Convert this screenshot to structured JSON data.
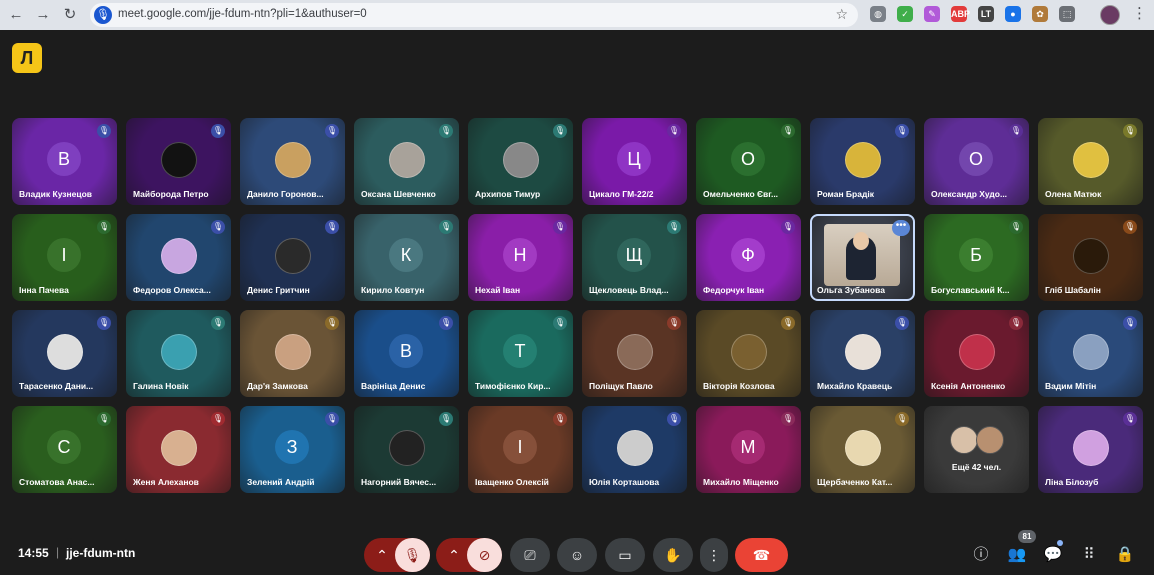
{
  "browser": {
    "url": "meet.google.com/jje-fdum-ntn?pli=1&authuser=0",
    "extensions": [
      {
        "name": "globe-icon",
        "color": "#7a8088",
        "glyph": "◍"
      },
      {
        "name": "shield-extension-icon",
        "color": "#3fae4a",
        "glyph": "✓"
      },
      {
        "name": "pen-extension-icon",
        "color": "#b15ad8",
        "glyph": "✎"
      },
      {
        "name": "adblock-extension-icon",
        "color": "#e23b3b",
        "glyph": "ABP"
      },
      {
        "name": "lt-extension-icon",
        "color": "#444",
        "glyph": "LT"
      },
      {
        "name": "blue-dot-extension-icon",
        "color": "#1a73e8",
        "glyph": "●"
      },
      {
        "name": "owl-extension-icon",
        "color": "#b07a3a",
        "glyph": "✿"
      },
      {
        "name": "puzzle-extensions-icon",
        "color": "#6b6f75",
        "glyph": "⬚"
      }
    ]
  },
  "meet": {
    "logo": "Л",
    "participants": [
      {
        "name": "Владик Кузнецов",
        "initial": "В",
        "bg": "#6a26a6",
        "avatar": "#7f3fbf",
        "mic": "#3b4fa8"
      },
      {
        "name": "Майборода Петро",
        "initial": "",
        "bg": "#3d1460",
        "avatar": "#121212",
        "mic": "#3b4fa8",
        "photo": true
      },
      {
        "name": "Данило Горонов...",
        "initial": "",
        "bg": "#2d4a78",
        "avatar": "#c9a060",
        "mic": "#3b4fa8",
        "photo": true
      },
      {
        "name": "Оксана Шевченко",
        "initial": "",
        "bg": "#2c5c5e",
        "avatar": "#a8a29a",
        "mic": "#2c7a74",
        "photo": true
      },
      {
        "name": "Архипов Тимур",
        "initial": "",
        "bg": "#1d4a42",
        "avatar": "#888",
        "mic": "#2c7a74",
        "photo": true
      },
      {
        "name": "Цикало ГМ-22/2",
        "initial": "Ц",
        "bg": "#7a1aa8",
        "avatar": "#8f34c4",
        "mic": "#6a28a0"
      },
      {
        "name": "Омельченко Євг...",
        "initial": "О",
        "bg": "#1e5a22",
        "avatar": "#2b6f2f",
        "mic": "#2c6a2f"
      },
      {
        "name": "Роман Брадік",
        "initial": "",
        "bg": "#2a3a6a",
        "avatar": "#d8b43a",
        "mic": "#3b4fa8",
        "photo": true
      },
      {
        "name": "Олександр Худо...",
        "initial": "О",
        "bg": "#5e2d96",
        "avatar": "#7346ad",
        "mic": "#5a2f96"
      },
      {
        "name": "Олена Матюк",
        "initial": "",
        "bg": "#565a2a",
        "avatar": "#e0c040",
        "mic": "#7a7a2a",
        "photo": true
      },
      {
        "name": "Інна Пачева",
        "initial": "І",
        "bg": "#285e1c",
        "avatar": "#38722b",
        "mic": "#2c6a2f"
      },
      {
        "name": "Федоров Олекса...",
        "initial": "",
        "bg": "#21466e",
        "avatar": "#c8a6e0",
        "mic": "#3b4fa8",
        "photo": true
      },
      {
        "name": "Денис Гритчин",
        "initial": "",
        "bg": "#1f3052",
        "avatar": "#2a2a2a",
        "mic": "#3b4fa8",
        "photo": true
      },
      {
        "name": "Кирило Ковтун",
        "initial": "К",
        "bg": "#38626a",
        "avatar": "#4a7880",
        "mic": "#2c7a74"
      },
      {
        "name": "Нехай Іван",
        "initial": "Н",
        "bg": "#8a1ea8",
        "avatar": "#a23ac2",
        "mic": "#6a28a0"
      },
      {
        "name": "Щекловець Влад...",
        "initial": "Щ",
        "bg": "#23524a",
        "avatar": "#2f665c",
        "mic": "#2c7a74"
      },
      {
        "name": "Федорчук Іван",
        "initial": "Ф",
        "bg": "#8a20b2",
        "avatar": "#a33ccb",
        "mic": "#6a28a0"
      },
      {
        "name": "Ольга Зубанова",
        "initial": "",
        "bg": "#3a3f4a",
        "avatar": "",
        "mic": "",
        "selfview": true
      },
      {
        "name": "Богуславський К...",
        "initial": "Б",
        "bg": "#2c6a22",
        "avatar": "#3b7e2f",
        "mic": "#2c6a2f"
      },
      {
        "name": "Гліб Шабалін",
        "initial": "",
        "bg": "#4a2a14",
        "avatar": "#2a1a0a",
        "mic": "#8a4a1a",
        "photo": true
      },
      {
        "name": "Тарасенко Дани...",
        "initial": "",
        "bg": "#24385e",
        "avatar": "#ddd",
        "mic": "#3b4fa8",
        "photo": true
      },
      {
        "name": "Галина Новік",
        "initial": "",
        "bg": "#1f5a5e",
        "avatar": "#3aa0b0",
        "mic": "#2c7a74",
        "photo": true
      },
      {
        "name": "Дар'я Замкова",
        "initial": "",
        "bg": "#6a5436",
        "avatar": "#c9a080",
        "mic": "#8a6a2a",
        "photo": true
      },
      {
        "name": "Варініца Денис",
        "initial": "В",
        "bg": "#1a4e8a",
        "avatar": "#2a62a6",
        "mic": "#3b4fa8"
      },
      {
        "name": "Тимофієнко Кир...",
        "initial": "Т",
        "bg": "#1a6a5e",
        "avatar": "#248072",
        "mic": "#2c7a74"
      },
      {
        "name": "Поліщук Павло",
        "initial": "",
        "bg": "#5a3424",
        "avatar": "#8a6a58",
        "mic": "#8a3a2a",
        "photo": true
      },
      {
        "name": "Вікторія Козлова",
        "initial": "",
        "bg": "#5a4a26",
        "avatar": "#7a6030",
        "mic": "#8a6a2a",
        "photo": true
      },
      {
        "name": "Михайло Кравець",
        "initial": "",
        "bg": "#2a4066",
        "avatar": "#e8e0d8",
        "mic": "#3b4fa8",
        "photo": true
      },
      {
        "name": "Ксенія Антоненко",
        "initial": "",
        "bg": "#6a1a2e",
        "avatar": "#c0304a",
        "mic": "#8a2a3a",
        "photo": true
      },
      {
        "name": "Вадим Мітін",
        "initial": "",
        "bg": "#2a4a7a",
        "avatar": "#8aa0c0",
        "mic": "#3b4fa8",
        "photo": true
      },
      {
        "name": "Стоматова Анас...",
        "initial": "С",
        "bg": "#2a5e1e",
        "avatar": "#38722b",
        "mic": "#2c6a2f"
      },
      {
        "name": "Женя Алеханов",
        "initial": "",
        "bg": "#8a2a30",
        "avatar": "#d8b090",
        "mic": "#a02a30",
        "photo": true
      },
      {
        "name": "Зелений Андрій",
        "initial": "З",
        "bg": "#1a5e8e",
        "avatar": "#2074b0",
        "mic": "#3b4fa8"
      },
      {
        "name": "Нагорний Вячес...",
        "initial": "",
        "bg": "#1c3a34",
        "avatar": "#222",
        "mic": "#2c7a74",
        "photo": true
      },
      {
        "name": "Іващенко Олексій",
        "initial": "І",
        "bg": "#6a3a26",
        "avatar": "#86503a",
        "mic": "#8a3a2a"
      },
      {
        "name": "Юлія Корташова",
        "initial": "",
        "bg": "#1e3a66",
        "avatar": "#ccc",
        "mic": "#3b4fa8",
        "photo": true
      },
      {
        "name": "Михайло Міщенко",
        "initial": "М",
        "bg": "#8a1a5a",
        "avatar": "#a52a72",
        "mic": "#8a2a5a"
      },
      {
        "name": "Щербаченко Кат...",
        "initial": "",
        "bg": "#6a5a34",
        "avatar": "#e8d8b0",
        "mic": "#8a6a2a",
        "photo": true
      },
      {
        "name": "",
        "initial": "",
        "bg": "#3a3a3a",
        "avatar": "",
        "mic": "",
        "more": true
      },
      {
        "name": "Ліна Білозуб",
        "initial": "",
        "bg": "#4a2a7a",
        "avatar": "#d0a0e0",
        "mic": "#5a2f96",
        "photo": true
      }
    ],
    "more_label": "Ещё 42 чел.",
    "clock": "14:55",
    "separator": "|",
    "meeting_code": "jje-fdum-ntn",
    "participants_count": "81"
  }
}
